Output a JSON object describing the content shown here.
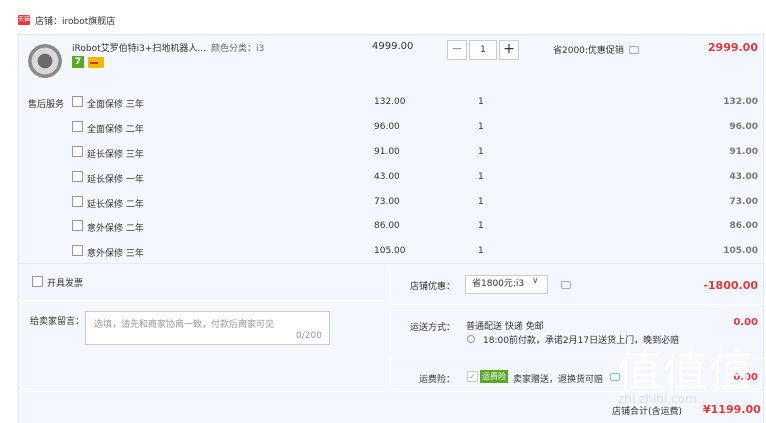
{
  "store": {
    "icon": "tmall-icon",
    "name": "店铺：irobot旗舰店"
  },
  "product": {
    "title": "iRobot艾罗伯特i3+扫地机器人...",
    "spec": "颜色分类：i3",
    "badge_number": "7",
    "unit_price": "4999.00",
    "quantity": "1",
    "minus": "−",
    "plus": "+",
    "promo": "省2000:优惠促销",
    "total": "2999.00"
  },
  "services": {
    "label": "售后服务",
    "items": [
      {
        "name": "全面保修 三年",
        "price": "132.00",
        "qty": "1",
        "total": "132.00"
      },
      {
        "name": "全面保修 二年",
        "price": "96.00",
        "qty": "1",
        "total": "96.00"
      },
      {
        "name": "延长保修 三年",
        "price": "91.00",
        "qty": "1",
        "total": "91.00"
      },
      {
        "name": "延长保修 一年",
        "price": "43.00",
        "qty": "1",
        "total": "43.00"
      },
      {
        "name": "延长保修 二年",
        "price": "73.00",
        "qty": "1",
        "total": "73.00"
      },
      {
        "name": "意外保修 二年",
        "price": "86.00",
        "qty": "1",
        "total": "86.00"
      },
      {
        "name": "意外保修 三年",
        "price": "105.00",
        "qty": "1",
        "total": "105.00"
      }
    ]
  },
  "invoice": {
    "label": "开具发票"
  },
  "message": {
    "label": "给卖家留言：",
    "placeholder": "选填，请先和商家协商一致，付款后商家可见",
    "counter": "0/200"
  },
  "coupon": {
    "label": "店铺优惠：",
    "selected": "省1800元:i3",
    "amount": "-1800.00"
  },
  "shipping": {
    "label": "运送方式：",
    "method": "普通配送 快递 免邮",
    "note": "18:00前付款，承诺2月17日送货上门，晚到必赔",
    "amount": "0.00"
  },
  "insurance": {
    "label": "运费险：",
    "tag": "运费险",
    "text": "卖家赠送，退换货可赔",
    "amount": "0.00"
  },
  "store_total": {
    "label": "店铺合计(含运费)",
    "amount": "¥1199.00"
  },
  "watermark": {
    "main": "值值值",
    "sub": "zhi.zhibi.com"
  },
  "colors": {
    "price_red": "#e4393c",
    "panel_bg": "#f4f8fe",
    "green": "#5aa829"
  }
}
